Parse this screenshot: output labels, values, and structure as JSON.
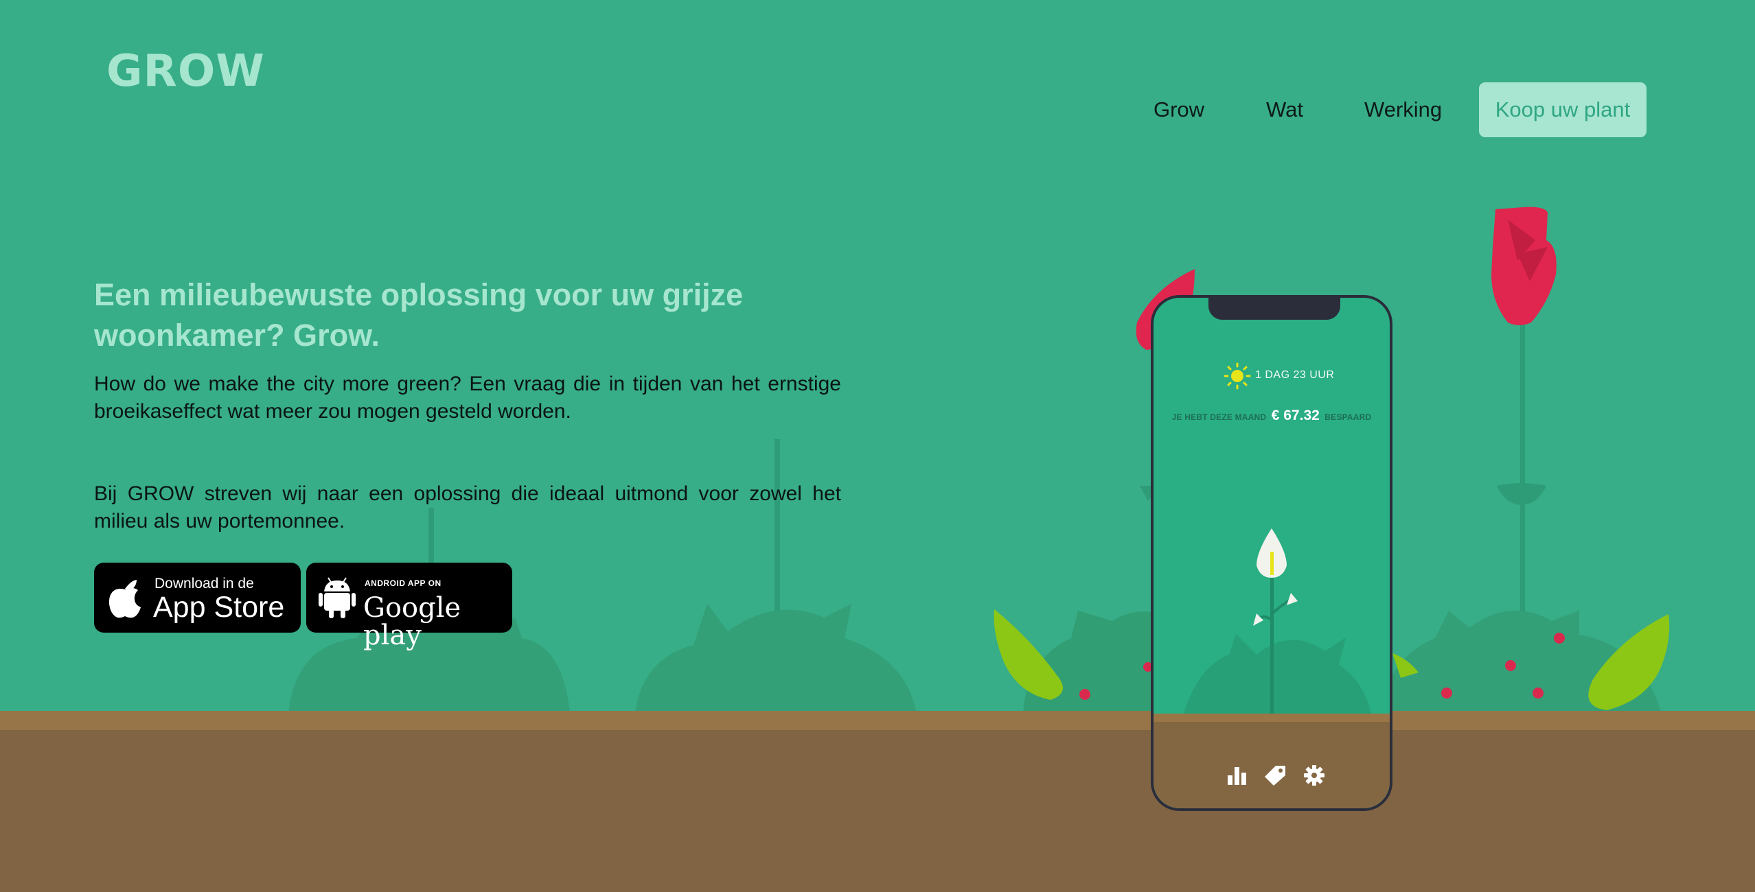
{
  "brand": {
    "logo_text": "GROW"
  },
  "nav": {
    "items": [
      "Grow",
      "Wat",
      "Werking"
    ],
    "cta_label": "Koop uw plant"
  },
  "hero": {
    "headline": "Een milieubewuste oplossing voor uw grijze woonkamer? Grow.",
    "paragraph1": "How do we make the city more green? Een vraag die in tijden van het ernstige broeikaseffect wat meer zou mogen gesteld worden.",
    "paragraph2": "Bij GROW streven wij naar een oplossing die ideaal uitmond voor zowel het milieu als uw portemonnee."
  },
  "badges": {
    "apple": {
      "small": "Download in de",
      "big": "App Store"
    },
    "google": {
      "small": "ANDROID APP ON",
      "big": "Google play"
    }
  },
  "phone": {
    "weather_icon": "sun-icon",
    "weather_text": "1 DAG 23 UUR",
    "saved_prefix": "JE HEBT DEZE MAAND",
    "saved_amount": "€ 67.32",
    "saved_suffix": "BESPAARD",
    "tabs": [
      "bar-chart-icon",
      "tag-icon",
      "gear-icon"
    ]
  },
  "colors": {
    "background": "#37ad88",
    "accent_light": "#a6e6cf",
    "soil": "#806443",
    "rose": "#e0264e",
    "leaf_lime": "#8cc716"
  }
}
